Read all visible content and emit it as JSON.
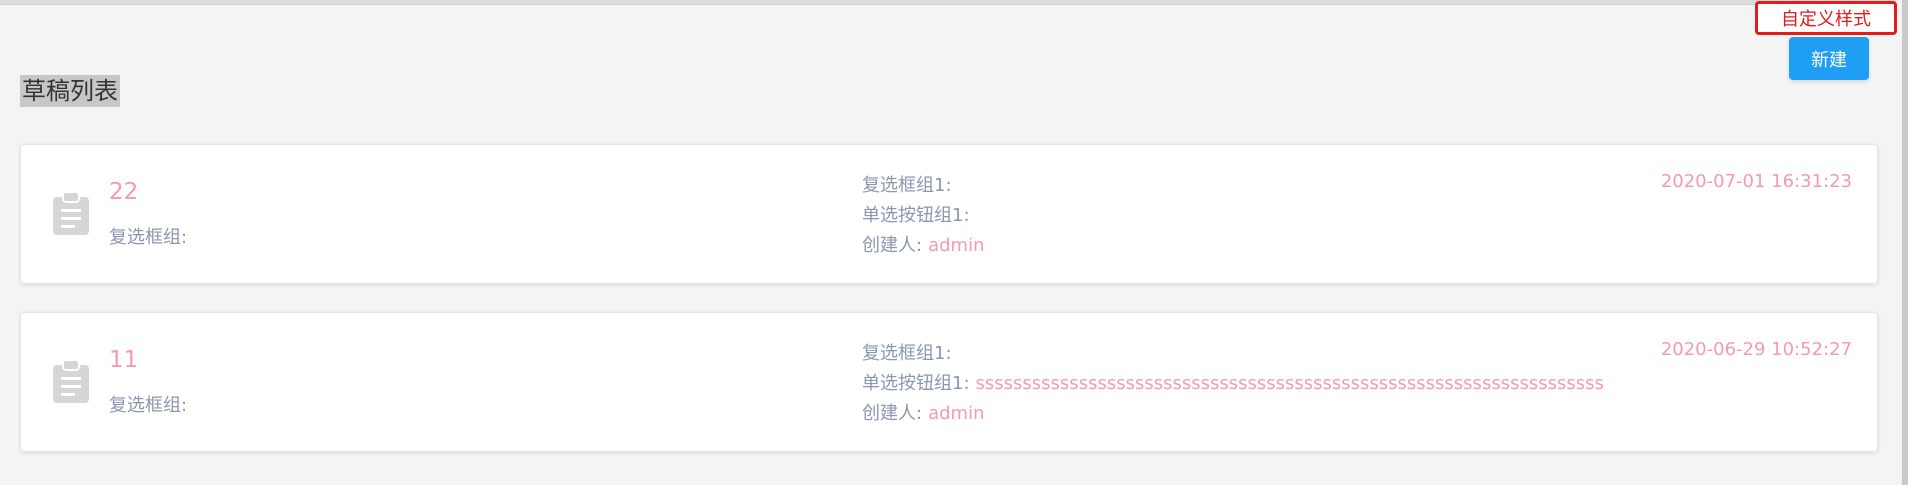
{
  "toolbar": {
    "custom_style_label": "自定义样式",
    "new_label": "新建"
  },
  "page": {
    "title": "草稿列表"
  },
  "drafts": [
    {
      "title": "22",
      "checkbox_group_label": "复选框组:",
      "checkbox_group1_label": "复选框组1:",
      "checkbox_group1_value": "",
      "radio_group1_label": "单选按钮组1:",
      "radio_group1_value": "",
      "creator_label": "创建人:",
      "creator_value": "admin",
      "date": "2020-07-01 16:31:23"
    },
    {
      "title": "11",
      "checkbox_group_label": "复选框组:",
      "checkbox_group1_label": "复选框组1:",
      "checkbox_group1_value": "",
      "radio_group1_label": "单选按钮组1:",
      "radio_group1_value": "sssssssssssssssssssssssssssssssssssssssssssssssssssssssssssssssssss",
      "creator_label": "创建人:",
      "creator_value": "admin",
      "date": "2020-06-29 10:52:27"
    }
  ],
  "icons": {
    "draft": "clipboard-icon"
  },
  "colors": {
    "accent_pink": "#f59ab0",
    "button_blue": "#1e9ef5",
    "custom_style_red": "#e21b1b",
    "label_gray": "#8a97ad"
  }
}
